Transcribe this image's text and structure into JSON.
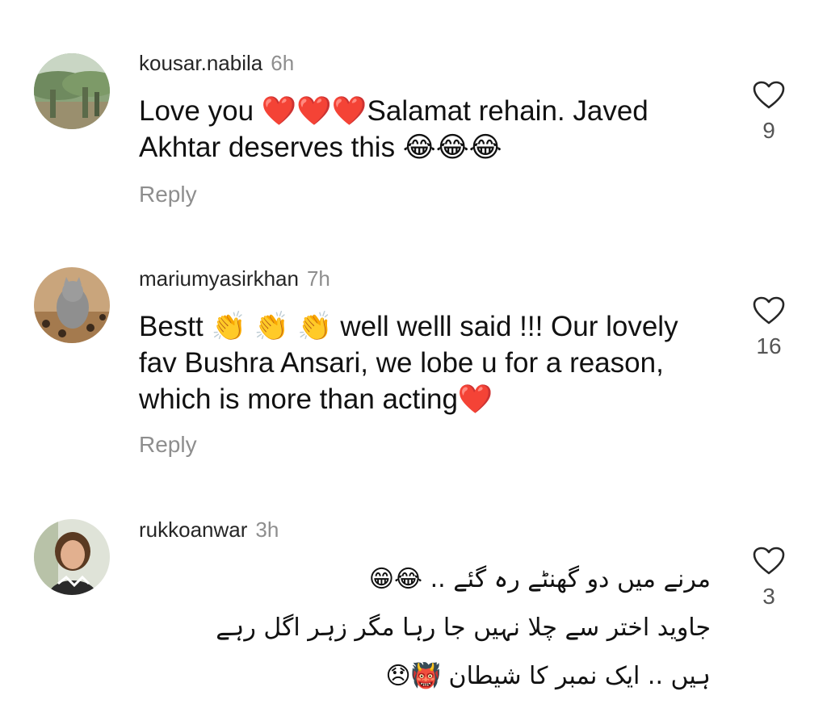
{
  "comments": [
    {
      "username": "kousar.nabila",
      "time": "6h",
      "text": "Love you ❤️❤️❤️Salamat rehain. Javed Akhtar deserves this 😂😂😂",
      "reply_label": "Reply",
      "likes": "9"
    },
    {
      "username": "mariumyasirkhan",
      "time": "7h",
      "text": "Bestt 👏 👏 👏  well welll said !!! Our lovely fav Bushra Ansari, we lobe u for a reason, which is more than acting❤️",
      "reply_label": "Reply",
      "likes": "16"
    },
    {
      "username": "rukkoanwar",
      "time": "3h",
      "text_lines": [
        "مرنے میں دو گھنٹے رہ گئے .. 😂😁",
        "جاوید اختر سے چلا نہیں جا رہا مگر زہر اگل رہے",
        "ہیں .. ایک نمبر کا شیطان 👹😞"
      ],
      "likes": "3"
    }
  ],
  "icons": {
    "like": "heart-outline-icon"
  },
  "colors": {
    "username": "#262626",
    "meta": "#8e8e8e",
    "text": "#111111"
  }
}
